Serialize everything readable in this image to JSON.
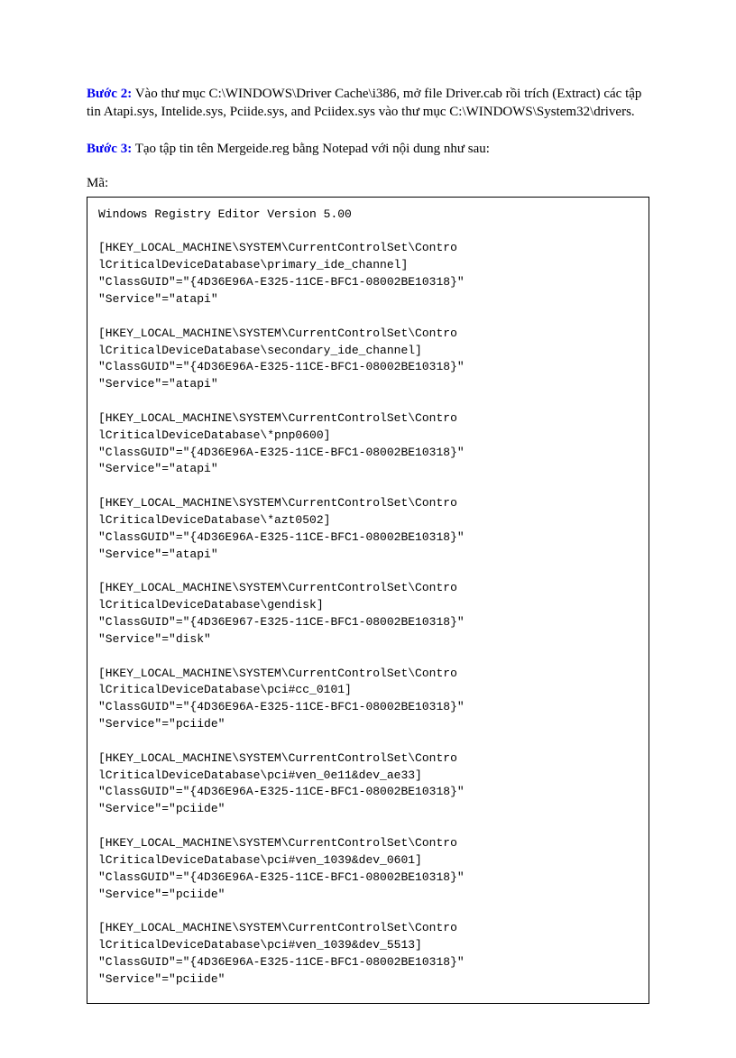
{
  "step2": {
    "label": "Bước 2:",
    "text": " Vào thư mục C:\\WINDOWS\\Driver Cache\\i386, mở file Driver.cab rồi trích (Extract) các tập tin Atapi.sys, Intelide.sys, Pciide.sys, and Pciidex.sys vào thư mục C:\\WINDOWS\\System32\\drivers."
  },
  "step3": {
    "label": "Bước 3:",
    "text": " Tạo tập tin tên Mergeide.reg bằng Notepad với nội dung như sau:"
  },
  "codeLabel": "Mã:",
  "code": "Windows Registry Editor Version 5.00\n\n[HKEY_LOCAL_MACHINE\\SYSTEM\\CurrentControlSet\\Contro\nlCriticalDeviceDatabase\\primary_ide_channel]\n\"ClassGUID\"=\"{4D36E96A-E325-11CE-BFC1-08002BE10318}\"\n\"Service\"=\"atapi\"\n\n[HKEY_LOCAL_MACHINE\\SYSTEM\\CurrentControlSet\\Contro\nlCriticalDeviceDatabase\\secondary_ide_channel]\n\"ClassGUID\"=\"{4D36E96A-E325-11CE-BFC1-08002BE10318}\"\n\"Service\"=\"atapi\"\n\n[HKEY_LOCAL_MACHINE\\SYSTEM\\CurrentControlSet\\Contro\nlCriticalDeviceDatabase\\*pnp0600]\n\"ClassGUID\"=\"{4D36E96A-E325-11CE-BFC1-08002BE10318}\"\n\"Service\"=\"atapi\"\n\n[HKEY_LOCAL_MACHINE\\SYSTEM\\CurrentControlSet\\Contro\nlCriticalDeviceDatabase\\*azt0502]\n\"ClassGUID\"=\"{4D36E96A-E325-11CE-BFC1-08002BE10318}\"\n\"Service\"=\"atapi\"\n\n[HKEY_LOCAL_MACHINE\\SYSTEM\\CurrentControlSet\\Contro\nlCriticalDeviceDatabase\\gendisk]\n\"ClassGUID\"=\"{4D36E967-E325-11CE-BFC1-08002BE10318}\"\n\"Service\"=\"disk\"\n\n[HKEY_LOCAL_MACHINE\\SYSTEM\\CurrentControlSet\\Contro\nlCriticalDeviceDatabase\\pci#cc_0101]\n\"ClassGUID\"=\"{4D36E96A-E325-11CE-BFC1-08002BE10318}\"\n\"Service\"=\"pciide\"\n\n[HKEY_LOCAL_MACHINE\\SYSTEM\\CurrentControlSet\\Contro\nlCriticalDeviceDatabase\\pci#ven_0e11&dev_ae33]\n\"ClassGUID\"=\"{4D36E96A-E325-11CE-BFC1-08002BE10318}\"\n\"Service\"=\"pciide\"\n\n[HKEY_LOCAL_MACHINE\\SYSTEM\\CurrentControlSet\\Contro\nlCriticalDeviceDatabase\\pci#ven_1039&dev_0601]\n\"ClassGUID\"=\"{4D36E96A-E325-11CE-BFC1-08002BE10318}\"\n\"Service\"=\"pciide\"\n\n[HKEY_LOCAL_MACHINE\\SYSTEM\\CurrentControlSet\\Contro\nlCriticalDeviceDatabase\\pci#ven_1039&dev_5513]\n\"ClassGUID\"=\"{4D36E96A-E325-11CE-BFC1-08002BE10318}\"\n\"Service\"=\"pciide\"\n"
}
